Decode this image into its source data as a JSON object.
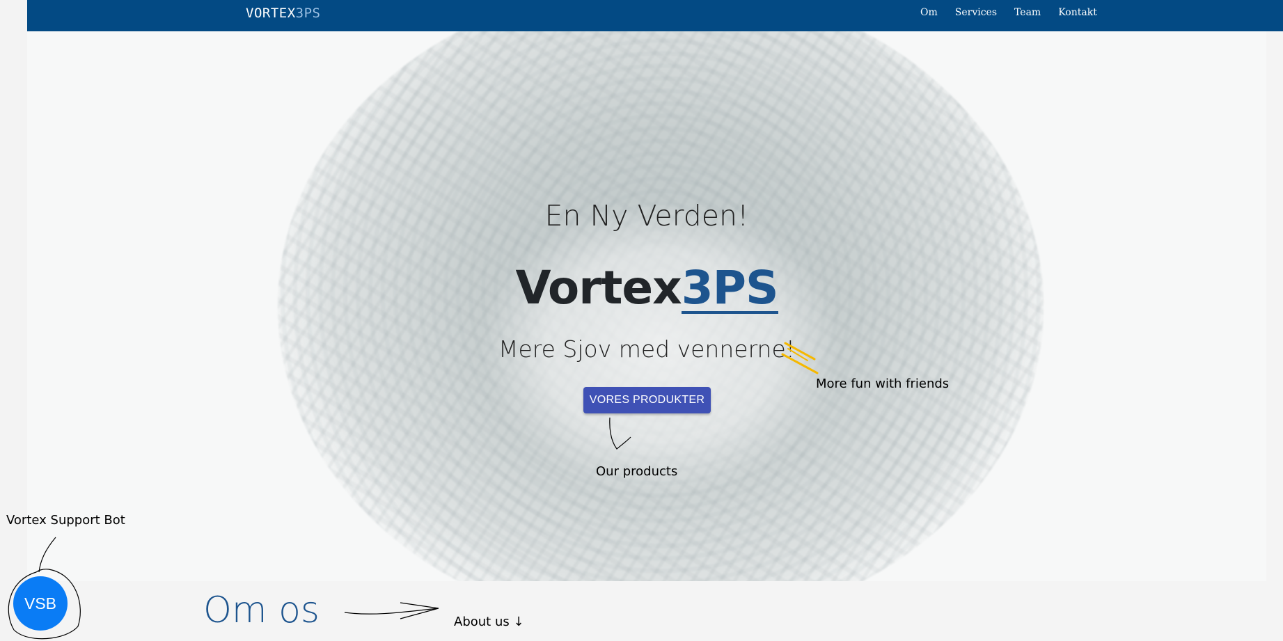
{
  "nav": {
    "brand_main": "VORTEX",
    "brand_accent": "3PS",
    "links": [
      "Om",
      "Services",
      "Team",
      "Kontakt"
    ]
  },
  "hero": {
    "subtitle": "En Ny Verden!",
    "title_main": "Vortex",
    "title_accent": "3PS",
    "tagline": "Mere Sjov med vennerne!",
    "cta_label": "VORES PRODUKTER"
  },
  "about": {
    "heading": "Om os"
  },
  "support_bot": {
    "label": "VSB"
  },
  "annotations": {
    "tagline_translation": "More fun with friends",
    "cta_translation": "Our products",
    "bot_label": "Vortex Support Bot",
    "about_translation": "About us ↓"
  },
  "colors": {
    "navbar": "#034a84",
    "accent": "#1d548e",
    "cta": "#3f51b5",
    "bot": "#0a7cf5",
    "highlight": "#f5b800"
  },
  "icons": {
    "about_arrow": "arrow-down-icon"
  }
}
